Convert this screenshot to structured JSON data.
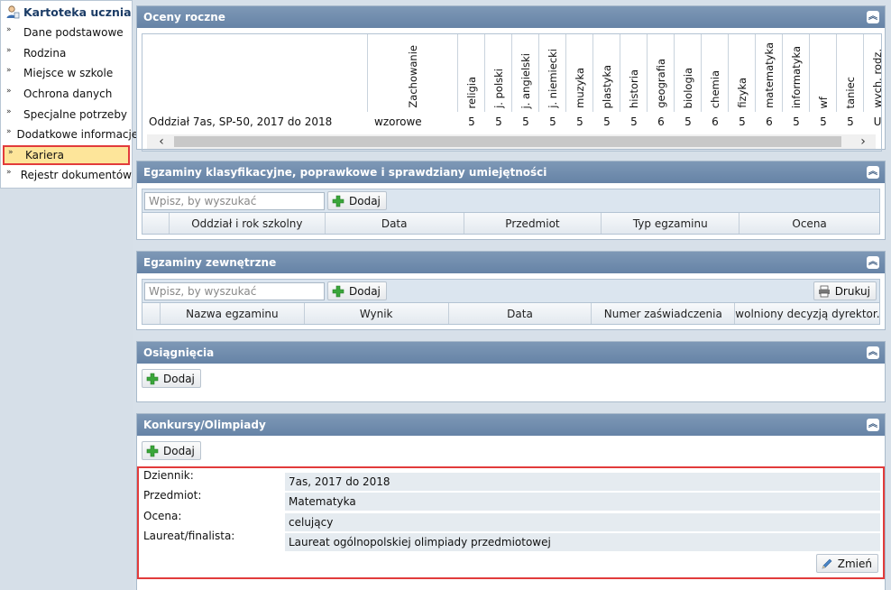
{
  "sidebar": {
    "title": "Kartoteka ucznia",
    "items": [
      {
        "label": "Dane podstawowe"
      },
      {
        "label": "Rodzina"
      },
      {
        "label": "Miejsce w szkole"
      },
      {
        "label": "Ochrona danych"
      },
      {
        "label": "Specjalne potrzeby"
      },
      {
        "label": "Dodatkowe informacje"
      },
      {
        "label": "Kariera"
      },
      {
        "label": "Rejestr dokumentów"
      }
    ],
    "active_index": 6
  },
  "oceny": {
    "title": "Oceny roczne",
    "conduct_header": "Zachowanie",
    "subjects": [
      "religia",
      "j. polski",
      "j. angielski",
      "j. niemiecki",
      "muzyka",
      "plastyka",
      "historia",
      "geografia",
      "biologia",
      "chemia",
      "fizyka",
      "matematyka",
      "informatyka",
      "wf",
      "taniec",
      "wych. rodz."
    ],
    "row": {
      "class_label": "Oddział 7as, SP-50, 2017 do 2018",
      "conduct": "wzorowe",
      "grades": [
        "5",
        "5",
        "5",
        "5",
        "5",
        "5",
        "5",
        "6",
        "5",
        "6",
        "5",
        "6",
        "5",
        "5",
        "5",
        "U"
      ]
    }
  },
  "egzaminy": {
    "title": "Egzaminy klasyfikacyjne, poprawkowe i sprawdziany umiejętności",
    "search_placeholder": "Wpisz, by wyszukać",
    "add_label": "Dodaj",
    "columns": [
      "Oddział i rok szkolny",
      "Data",
      "Przedmiot",
      "Typ egzaminu",
      "Ocena"
    ]
  },
  "zewnetrzne": {
    "title": "Egzaminy zewnętrzne",
    "search_placeholder": "Wpisz, by wyszukać",
    "add_label": "Dodaj",
    "print_label": "Drukuj",
    "columns": [
      "Nazwa egzaminu",
      "Wynik",
      "Data",
      "Numer zaświadczenia",
      "Zwolniony decyzją dyrektor..."
    ]
  },
  "osiagniecia": {
    "title": "Osiągnięcia",
    "add_label": "Dodaj"
  },
  "konkursy": {
    "title": "Konkursy/Olimpiady",
    "add_label": "Dodaj",
    "fields": [
      {
        "label": "Dziennik:",
        "value": "7as, 2017 do 2018"
      },
      {
        "label": "Przedmiot:",
        "value": "Matematyka"
      },
      {
        "label": "Ocena:",
        "value": "celujący"
      },
      {
        "label": "Laureat/finalista:",
        "value": "Laureat ogólnopolskiej olimpiady przedmiotowej"
      }
    ],
    "change_label": "Zmień"
  },
  "icons": [
    "user-icon",
    "chevron-double-right-icon",
    "collapse-up-icon",
    "plus-icon",
    "printer-icon",
    "pencil-icon",
    "scroll-left-icon",
    "scroll-right-icon"
  ]
}
